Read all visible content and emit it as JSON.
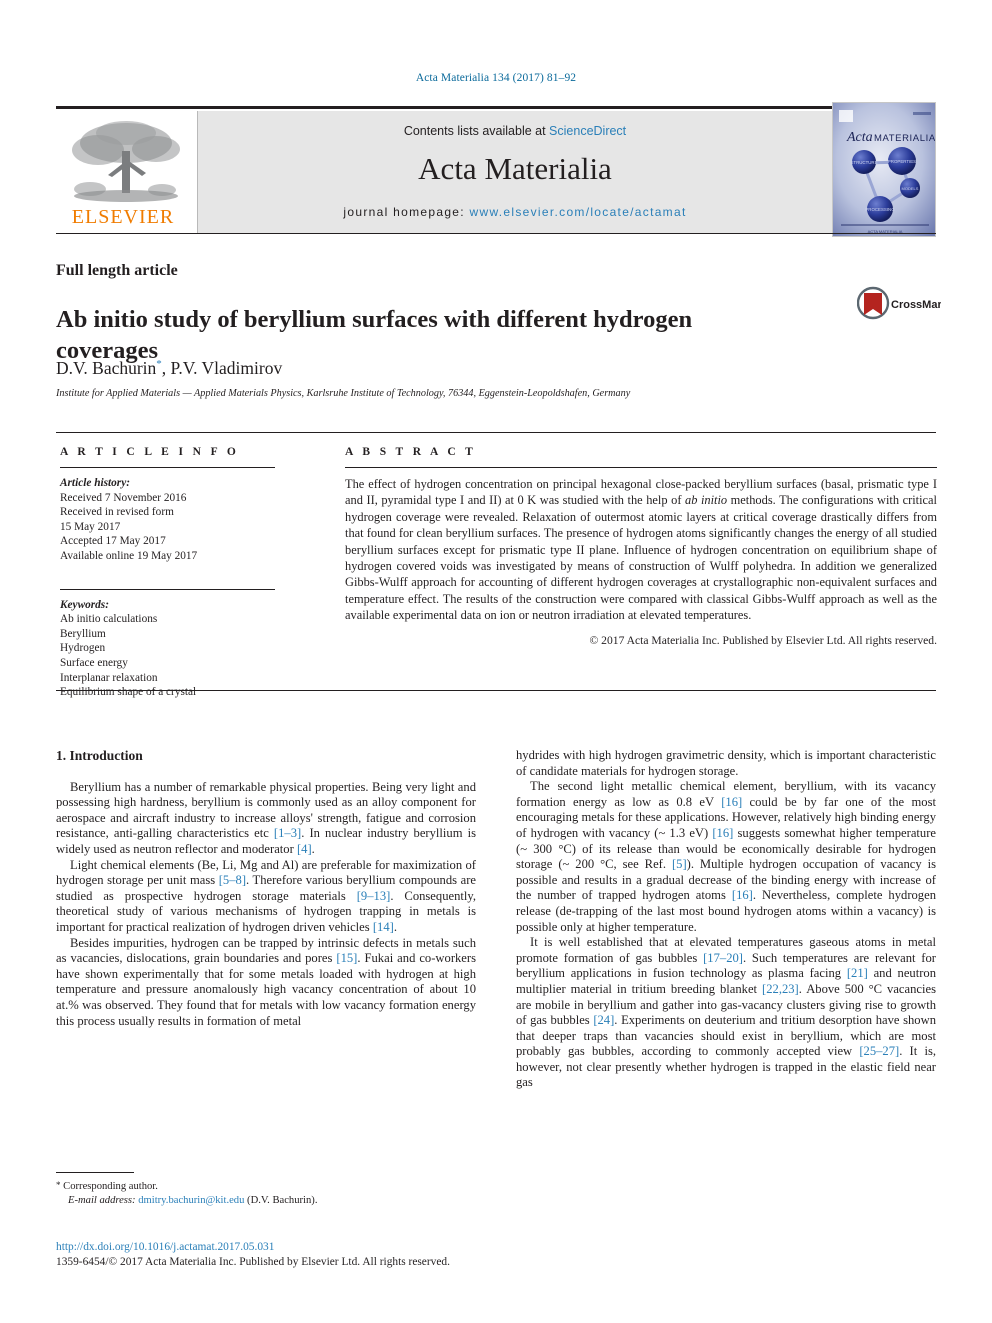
{
  "running_head": "Acta Materialia 134 (2017) 81–92",
  "masthead": {
    "contents_prefix": "Contents lists available at ",
    "sciencedirect": "ScienceDirect",
    "journal_title": "Acta Materialia",
    "homepage_label": "journal homepage: ",
    "homepage_url": "www.elsevier.com/locate/actamat",
    "publisher_logo_text": "ELSEVIER",
    "cover": {
      "journal_name_italic": "Acta",
      "journal_name_caps": "MATERIALIA",
      "nodes": [
        "STRUCTURE",
        "PROPERTIES",
        "MODELS",
        "PROCESSING"
      ]
    }
  },
  "article": {
    "kind": "Full length article",
    "title": "Ab initio study of beryllium surfaces with different hydrogen coverages",
    "authors": "D.V. Bachurin",
    "authors_second": ", P.V. Vladimirov",
    "corresponding_marker": "*",
    "affiliation": "Institute for Applied Materials — Applied Materials Physics, Karlsruhe Institute of Technology, 76344, Eggenstein-Leopoldshafen, Germany",
    "crossmark_label": "CrossMark"
  },
  "info": {
    "heading": "A R T I C L E  I N F O",
    "history_label": "Article history:",
    "history": [
      "Received 7 November 2016",
      "Received in revised form",
      "15 May 2017",
      "Accepted 17 May 2017",
      "Available online 19 May 2017"
    ],
    "keywords_label": "Keywords:",
    "keywords": [
      "Ab initio calculations",
      "Beryllium",
      "Hydrogen",
      "Surface energy",
      "Interplanar relaxation",
      "Equilibrium shape of a crystal"
    ]
  },
  "abstract": {
    "heading": "A B S T R A C T",
    "part1": "The effect of hydrogen concentration on principal hexagonal close-packed beryllium surfaces (basal, prismatic type I and II, pyramidal type I and II) at 0 K was studied with the help of ",
    "italic_term": "ab initio",
    "part2": " methods. The configurations with critical hydrogen coverage were revealed. Relaxation of outermost atomic layers at critical coverage drastically differs from that found for clean beryllium surfaces. The presence of hydrogen atoms significantly changes the energy of all studied beryllium surfaces except for prismatic type II plane. Influence of hydrogen concentration on equilibrium shape of hydrogen covered voids was investigated by means of construction of Wulff polyhedra. In addition we generalized Gibbs-Wulff approach for accounting of different hydrogen coverages at crystallographic non-equivalent surfaces and temperature effect. The results of the construction were compared with classical Gibbs-Wulff approach as well as the available experimental data on ion or neutron irradiation at elevated temperatures.",
    "copyright": "© 2017 Acta Materialia Inc. Published by Elsevier Ltd. All rights reserved."
  },
  "body": {
    "section_heading": "1. Introduction",
    "left_paragraphs": [
      {
        "segments": [
          {
            "t": "Beryllium has a number of remarkable physical properties. Being very light and possessing high hardness, beryllium is commonly used as an alloy component for aerospace and aircraft industry to increase alloys' strength, fatigue and corrosion resistance, anti-galling characteristics etc "
          },
          {
            "t": "[1–3]",
            "ref": true
          },
          {
            "t": ". In nuclear industry beryllium is widely used as neutron reflector and moderator "
          },
          {
            "t": "[4]",
            "ref": true
          },
          {
            "t": "."
          }
        ]
      },
      {
        "segments": [
          {
            "t": "Light chemical elements (Be, Li, Mg and Al) are preferable for maximization of hydrogen storage per unit mass "
          },
          {
            "t": "[5–8]",
            "ref": true
          },
          {
            "t": ". Therefore various beryllium compounds are studied as prospective hydrogen storage materials "
          },
          {
            "t": "[9–13]",
            "ref": true
          },
          {
            "t": ". Consequently, theoretical study of various mechanisms of hydrogen trapping in metals is important for practical realization of hydrogen driven vehicles "
          },
          {
            "t": "[14]",
            "ref": true
          },
          {
            "t": "."
          }
        ]
      },
      {
        "segments": [
          {
            "t": "Besides impurities, hydrogen can be trapped by intrinsic defects in metals such as vacancies, dislocations, grain boundaries and pores "
          },
          {
            "t": "[15]",
            "ref": true
          },
          {
            "t": ". Fukai and co-workers have shown experimentally that for some metals loaded with hydrogen at high temperature and pressure anomalously high vacancy concentration of about 10 at.% was observed. They found that for metals with low vacancy formation energy this process usually results in formation of metal"
          }
        ]
      }
    ],
    "right_paragraphs": [
      {
        "noindent": true,
        "segments": [
          {
            "t": "hydrides with high hydrogen gravimetric density, which is important characteristic of candidate materials for hydrogen storage."
          }
        ]
      },
      {
        "segments": [
          {
            "t": "The second light metallic chemical element, beryllium, with its vacancy formation energy as low as 0.8 eV "
          },
          {
            "t": "[16]",
            "ref": true
          },
          {
            "t": " could be by far one of the most encouraging metals for these applications. However, relatively high binding energy of hydrogen with vacancy (~ 1.3 eV) "
          },
          {
            "t": "[16]",
            "ref": true
          },
          {
            "t": " suggests somewhat higher temperature (~ 300 °C) of its release than would be economically desirable for hydrogen storage (~ 200 °C, see Ref. "
          },
          {
            "t": "[5]",
            "ref": true
          },
          {
            "t": "). Multiple hydrogen occupation of vacancy is possible and results in a gradual decrease of the binding energy with increase of the number of trapped hydrogen atoms "
          },
          {
            "t": "[16]",
            "ref": true
          },
          {
            "t": ". Nevertheless, complete hydrogen release (de-trapping of the last most bound hydrogen atoms within a vacancy) is possible only at higher temperature."
          }
        ]
      },
      {
        "segments": [
          {
            "t": "It is well established that at elevated temperatures gaseous atoms in metal promote formation of gas bubbles "
          },
          {
            "t": "[17–20]",
            "ref": true
          },
          {
            "t": ". Such temperatures are relevant for beryllium applications in fusion technology as plasma facing "
          },
          {
            "t": "[21]",
            "ref": true
          },
          {
            "t": " and neutron multiplier material in tritium breeding blanket "
          },
          {
            "t": "[22,23]",
            "ref": true
          },
          {
            "t": ". Above 500 °C vacancies are mobile in beryllium and gather into gas-vacancy clusters giving rise to growth of gas bubbles "
          },
          {
            "t": "[24]",
            "ref": true
          },
          {
            "t": ". Experiments on deuterium and tritium desorption have shown that deeper traps than vacancies should exist in beryllium, which are most probably gas bubbles, according to commonly accepted view "
          },
          {
            "t": "[25–27]",
            "ref": true
          },
          {
            "t": ". It is, however, not clear presently whether hydrogen is trapped in the elastic field near gas"
          }
        ]
      }
    ]
  },
  "footer": {
    "corresponding_marker": "*",
    "corresponding_text": "Corresponding author.",
    "email_label": "E-mail address:",
    "email": "dmitry.bachurin@kit.edu",
    "email_owner": "(D.V. Bachurin).",
    "doi": "http://dx.doi.org/10.1016/j.actamat.2017.05.031",
    "issn_line": "1359-6454/© 2017 Acta Materialia Inc. Published by Elsevier Ltd. All rights reserved."
  },
  "colors": {
    "link": "#2a7fb8",
    "runhead": "#0b6a9b",
    "elsevier_orange": "#f07c00",
    "masthead_bg": "#e6e6e6"
  }
}
